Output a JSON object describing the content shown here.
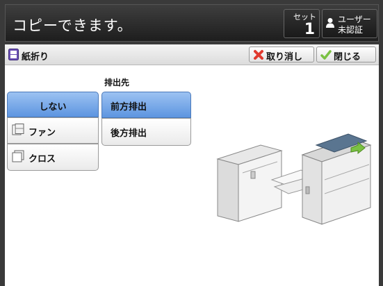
{
  "header": {
    "message": "コピーできます。",
    "set_label": "セット",
    "set_count": "1",
    "user_line1": "ユーザー",
    "user_line2": "未認証"
  },
  "panel": {
    "title": "紙折り",
    "cancel_label": "取り消し",
    "close_label": "閉じる"
  },
  "fold_options": [
    {
      "label": "しない",
      "selected": true
    },
    {
      "label": "ファン",
      "icon": "fan-fold-icon",
      "selected": false
    },
    {
      "label": "クロス",
      "icon": "cross-fold-icon",
      "selected": false
    }
  ],
  "output": {
    "section_label": "排出先",
    "options": [
      {
        "label": "前方排出",
        "selected": true
      },
      {
        "label": "後方排出",
        "selected": false
      }
    ]
  },
  "colors": {
    "selected": "#5d95e0",
    "header_bg": "#1e1e1e",
    "arrow_green": "#7ac143",
    "cancel_red": "#e03a2f"
  }
}
